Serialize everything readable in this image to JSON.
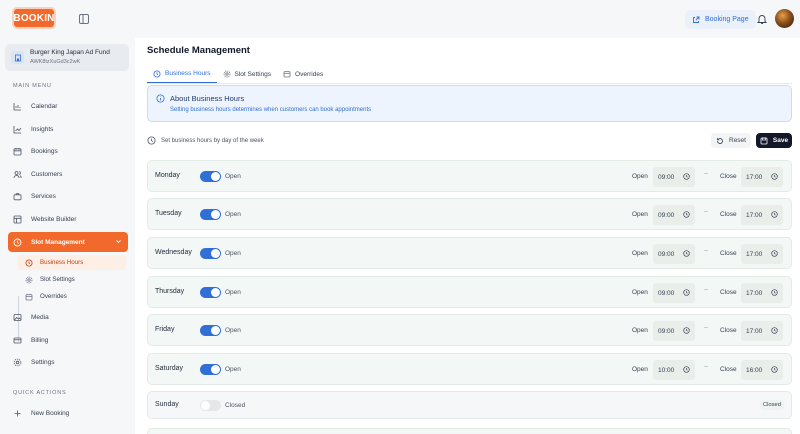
{
  "app": {
    "logo_text": "BOOKIN",
    "booking_page_label": "Booking Page",
    "accent_color": "#f26a2b",
    "primary_color": "#2f6fd6"
  },
  "sidebar": {
    "org_name": "Burger King Japan Ad Fund",
    "org_id": "AWK8tzXuGd3c2wK",
    "main_menu_label": "MAIN MENU",
    "quick_actions_label": "QUICK ACTIONS",
    "items": [
      {
        "label": "Calendar",
        "icon": "bar-chart-icon"
      },
      {
        "label": "Insights",
        "icon": "chart-icon"
      },
      {
        "label": "Bookings",
        "icon": "calendar-icon"
      },
      {
        "label": "Customers",
        "icon": "users-icon"
      },
      {
        "label": "Services",
        "icon": "briefcase-icon"
      },
      {
        "label": "Website Builder",
        "icon": "layout-icon"
      },
      {
        "label": "Slot Management",
        "icon": "clock-icon"
      },
      {
        "label": "Media",
        "icon": "media-icon"
      },
      {
        "label": "Billing",
        "icon": "card-icon"
      },
      {
        "label": "Settings",
        "icon": "gear-icon"
      }
    ],
    "sub_items": [
      {
        "label": "Business Hours"
      },
      {
        "label": "Slot Settings"
      },
      {
        "label": "Overrides"
      }
    ],
    "quick_new_booking": "New Booking"
  },
  "main": {
    "title": "Schedule Management",
    "tabs": [
      {
        "label": "Business Hours"
      },
      {
        "label": "Slot Settings"
      },
      {
        "label": "Overrides"
      }
    ],
    "info_title": "About Business Hours",
    "info_text": "Setting business hours determines when customers can book appointments",
    "hint": "Set business hours by day of the week",
    "reset_label": "Reset",
    "save_label": "Save",
    "open_label": "Open",
    "close_label": "Close",
    "days": [
      {
        "name": "Monday",
        "status": "Open",
        "open": "09:00",
        "close": "17:00"
      },
      {
        "name": "Tuesday",
        "status": "Open",
        "open": "09:00",
        "close": "17:00"
      },
      {
        "name": "Wednesday",
        "status": "Open",
        "open": "09:00",
        "close": "17:00"
      },
      {
        "name": "Thursday",
        "status": "Open",
        "open": "09:00",
        "close": "17:00"
      },
      {
        "name": "Friday",
        "status": "Open",
        "open": "09:00",
        "close": "17:00"
      },
      {
        "name": "Saturday",
        "status": "Open",
        "open": "10:00",
        "close": "16:00"
      },
      {
        "name": "Sunday",
        "status": "Closed",
        "badge": "Closed"
      }
    ]
  }
}
